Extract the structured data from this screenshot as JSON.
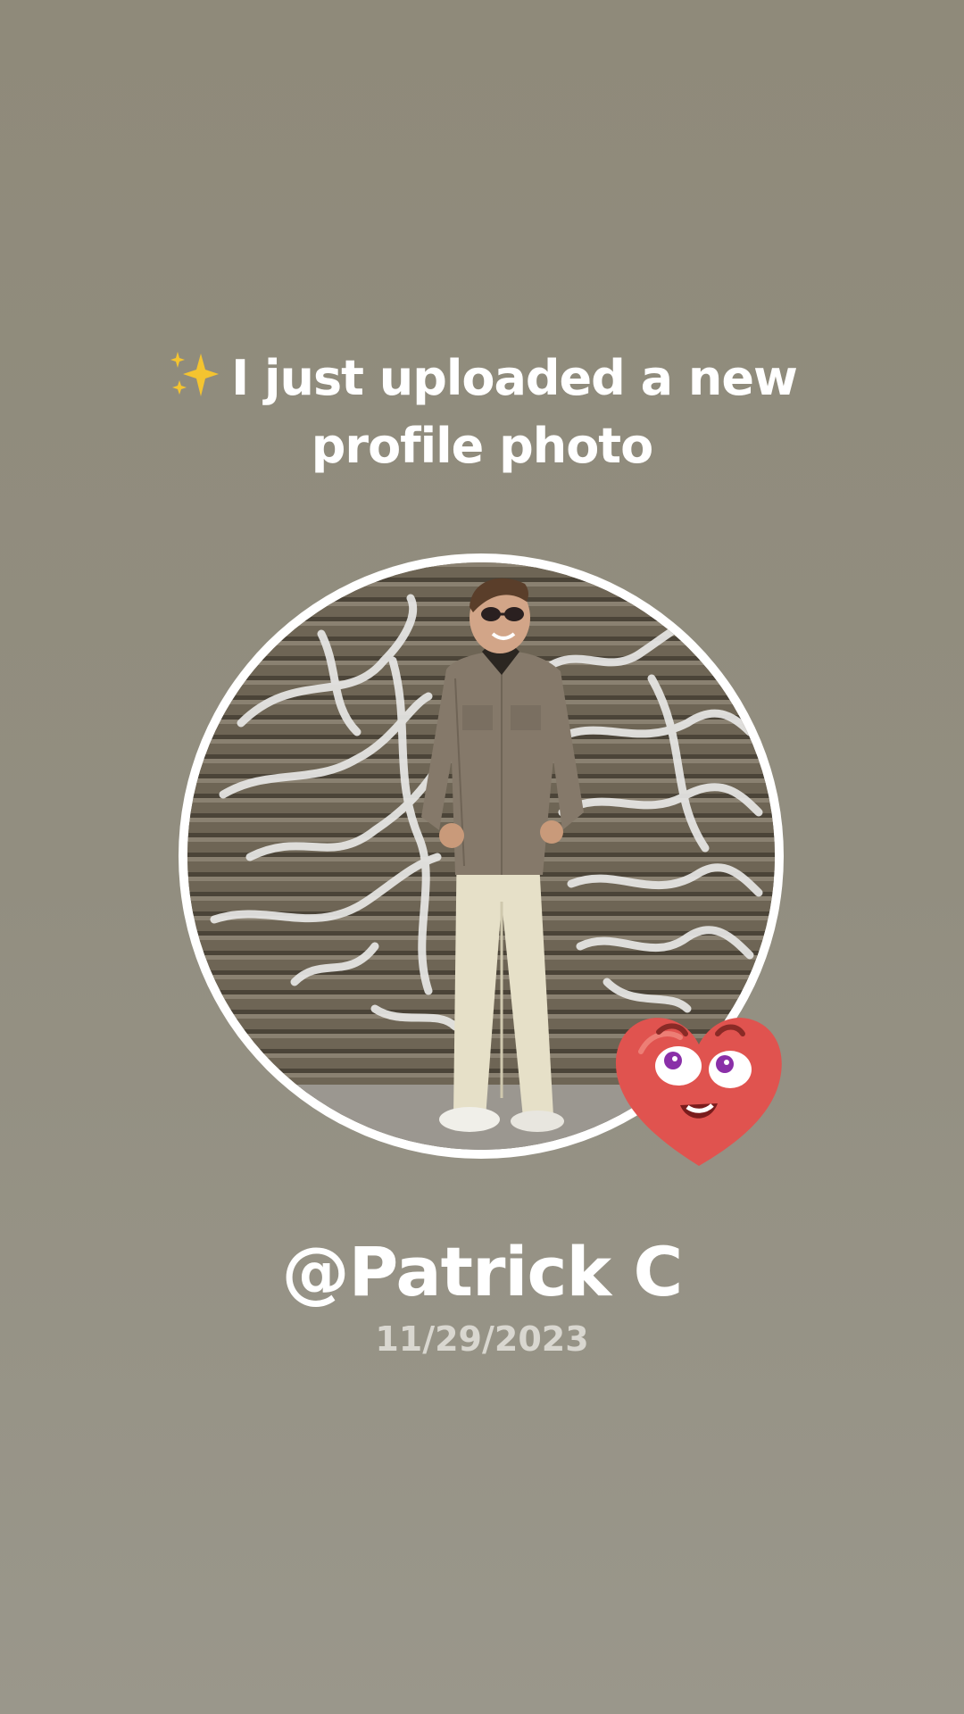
{
  "post": {
    "headline_icon": "sparkles-icon",
    "headline_line1": "I just uploaded a new",
    "headline_line2": "profile photo",
    "username": "@Patrick C",
    "date": "11/29/2023"
  },
  "sticker": {
    "icon": "heart-face-icon"
  },
  "colors": {
    "background": "#928e80",
    "text": "#ffffff",
    "date_text": "#d9d7d0",
    "ring": "#ffffff",
    "heart": "#e0534f"
  }
}
